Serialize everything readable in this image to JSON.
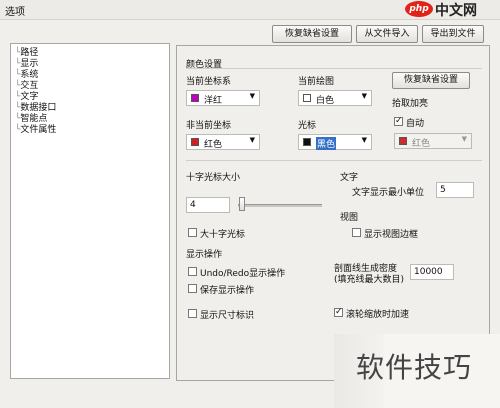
{
  "window": {
    "title": "选项"
  },
  "watermark_top": {
    "logo_text": "php",
    "site_text": "中文网"
  },
  "watermark_bottom": {
    "text": "软件技巧"
  },
  "toolbar": {
    "restore_defaults": "恢复缺省设置",
    "import_from_file": "从文件导入",
    "export_to_file": "导出到文件"
  },
  "tree": {
    "items": [
      "路径",
      "显示",
      "系统",
      "交互",
      "文字",
      "数据接口",
      "智能点",
      "文件属性"
    ]
  },
  "color_settings": {
    "section_title": "颜色设置",
    "current_coord_label": "当前坐标系",
    "current_coord_value": "洋红",
    "current_coord_color": "#c000c0",
    "current_drawing_label": "当前绘图",
    "current_drawing_value": "白色",
    "current_drawing_color": "#ffffff",
    "restore_defaults_btn": "恢复缺省设置",
    "non_current_coord_label": "非当前坐标",
    "non_current_coord_value": "红色",
    "non_current_coord_color": "#d02020",
    "cursor_label": "光标",
    "cursor_value": "黑色",
    "cursor_color": "#111111",
    "highlight_label": "拾取加亮",
    "auto_label": "自动",
    "auto_checked": true,
    "highlight_value": "红色",
    "highlight_color": "#c83030"
  },
  "crosshair": {
    "title": "十字光标大小",
    "value": "4",
    "slider_fraction": 0.0,
    "large_crosshair_label": "大十字光标",
    "large_crosshair_checked": false
  },
  "text_group": {
    "title": "文字",
    "min_unit_label": "文字显示最小单位",
    "min_unit_value": "5"
  },
  "view_group": {
    "title": "视图",
    "show_border_label": "显示视图边框",
    "show_border_checked": false
  },
  "display_ops": {
    "title": "显示操作",
    "undo_redo_label": "Undo/Redo显示操作",
    "undo_redo_checked": false,
    "save_display_label": "保存显示操作",
    "save_display_checked": false
  },
  "hatch": {
    "label_line1": "剖面线生成密度",
    "label_line2": "(填充线最大数目)",
    "value": "10000"
  },
  "size_mark": {
    "label": "显示尺寸标识",
    "checked": false
  },
  "wheel_zoom": {
    "label": "滚轮缩放时加速",
    "checked": true
  }
}
